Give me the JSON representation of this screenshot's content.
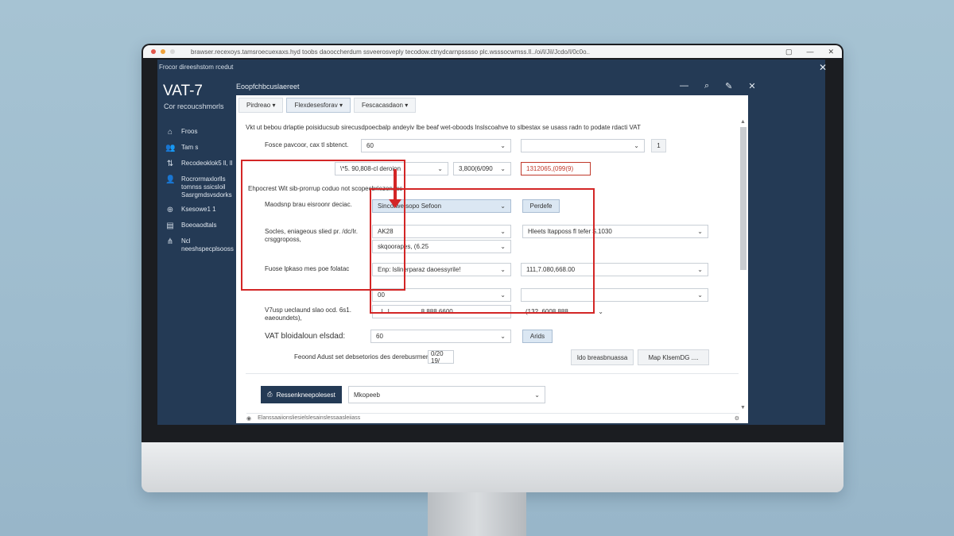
{
  "browser": {
    "url": "brawser.recexoys.tamsroecuexaxs.hyd toobs daooccherdum ssveerosveply tecodow.ctnydcarnpsssso plc.wsssocwmss.ll../oi/l/Jil/Jcdo/l/0c0o..",
    "controls": [
      "▢",
      "—",
      "✕"
    ]
  },
  "app": {
    "window_title": "Frocor direeshstom rcedut",
    "close": "✕"
  },
  "sidebar": {
    "title": "VAT-7",
    "subtitle": "Cor recoucshmorls",
    "items": [
      {
        "icon": "home-icon",
        "label": "Froos"
      },
      {
        "icon": "users-icon",
        "label": "Tam s"
      },
      {
        "icon": "transfer-icon",
        "label": "Recodeoklok5 ll, ll"
      },
      {
        "icon": "person-icon",
        "label": "Rocrormaxlorlls tomnss ssicsloil Sasrgmdsvsdorks"
      },
      {
        "icon": "globe-icon",
        "label": "Ksesowe1 1"
      },
      {
        "icon": "document-icon",
        "label": "Boeoaodtals"
      },
      {
        "icon": "network-icon",
        "label": "Ncl neeshspecplsooss"
      }
    ]
  },
  "header": {
    "title": "Eoopfchbcuslaereet",
    "icons": [
      "minimize-icon",
      "search-icon",
      "edit-icon",
      "close-icon"
    ]
  },
  "tabs": [
    {
      "label": "Pirdreao ▾"
    },
    {
      "label": "Flexdesesforav ▾"
    },
    {
      "label": "Fescacasdaon ▾"
    }
  ],
  "description": "Vkt ut bebou drlaptie poisiducsub sirecusdpoecbalp andeyiv lbe beaf wet-oboods lnslscoahve to slbestax se usass radn to podate rdacti VAT",
  "form": {
    "row1": {
      "label": "Fosce pavcoor, cax tl sbtenct.",
      "field1": "60",
      "field2": "",
      "button": "1"
    },
    "row2": {
      "field1": "\\*5. 90,808-cl deroion",
      "field2": "3,800(6/090",
      "field3": "1312065,(099(9)"
    },
    "section_note": "Ehpocrest Wit sib-prorrup coduo not scopecbriezonacs",
    "row3": {
      "label": "Maodsnp brau eisroonr deciac.",
      "field": "Sincorwe sopo Sefoon",
      "button": "Perdefe"
    },
    "row4": {
      "label": "Socles, eniageous slied pr. /dc/Ir. crsggroposs,",
      "field1": "AK28",
      "field2": "Hleets ltapposs fl tefer $.1030"
    },
    "row5": {
      "field": "skqoorapes, (6.25"
    },
    "row6": {
      "label": "Fuose lpkaso mes poe folatac",
      "field1": "Enp: lslinerparaz daoessyrile!",
      "field2": "111,7.080,668.00"
    },
    "row7": {
      "field1": "00",
      "field2": ""
    },
    "row8": {
      "label": "V7usp ueclaund slao ocd. 6s1. eaeoundets),",
      "field1": "..l...l.... ..... ...... 8 888 6600",
      "field2": "(132. 6008 888"
    },
    "row9": {
      "label": "VAT bloidaloun elsdad:",
      "field": "60",
      "button": "Arids"
    },
    "row10": {
      "label": "Feoond Adust set debsetorios des derebusrmerozt",
      "field": "0/20 19/",
      "button1": "Ido breasbnuassa",
      "button2": "Map KlsemDG ...."
    }
  },
  "footer": {
    "primary_button": "Ressenkneepolesest",
    "select": "Mkopeeb",
    "bar_text": "Elanssaaiionsliesielslesainslessaasleiiass"
  }
}
